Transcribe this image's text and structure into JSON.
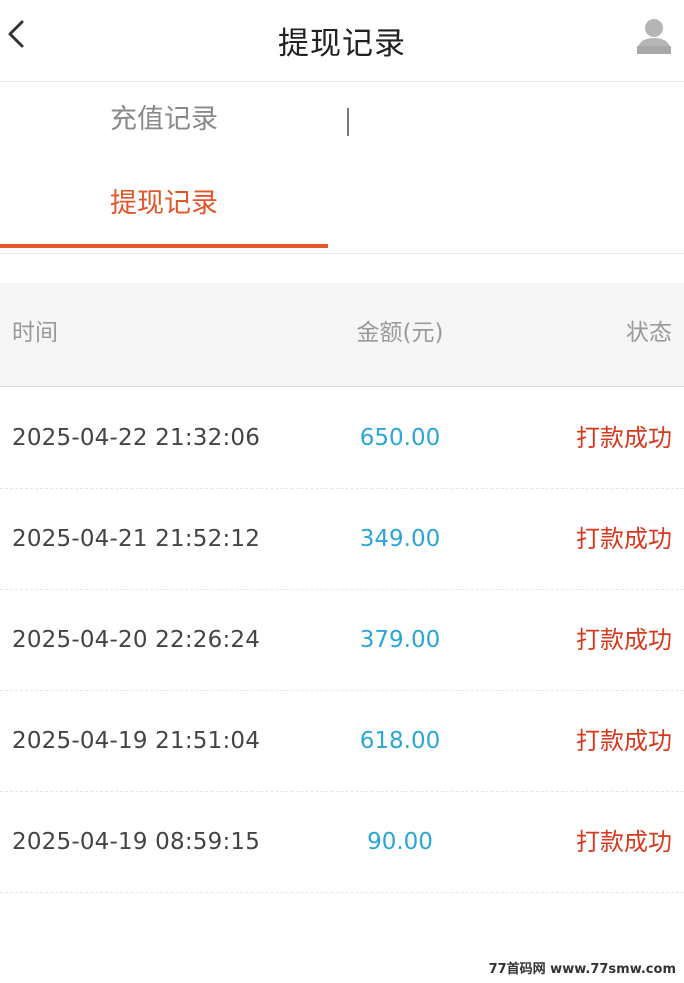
{
  "header": {
    "title": "提现记录",
    "back_icon": "chevron-left-icon",
    "avatar_icon": "user-icon"
  },
  "tabs": {
    "recharge_label": "充值记录",
    "withdraw_label": "提现记录",
    "active": "withdraw"
  },
  "table": {
    "headers": {
      "time": "时间",
      "amount": "金额(元)",
      "status": "状态"
    },
    "rows": [
      {
        "time": "2025-04-22 21:32:06",
        "amount": "650.00",
        "status": "打款成功"
      },
      {
        "time": "2025-04-21 21:52:12",
        "amount": "349.00",
        "status": "打款成功"
      },
      {
        "time": "2025-04-20 22:26:24",
        "amount": "379.00",
        "status": "打款成功"
      },
      {
        "time": "2025-04-19 21:51:04",
        "amount": "618.00",
        "status": "打款成功"
      },
      {
        "time": "2025-04-19 08:59:15",
        "amount": "90.00",
        "status": "打款成功"
      }
    ]
  },
  "watermark": "77首码网 www.77smw.com",
  "colors": {
    "accent": "#e2562a",
    "amount": "#2aa6d9",
    "status_success": "#d8391e"
  }
}
